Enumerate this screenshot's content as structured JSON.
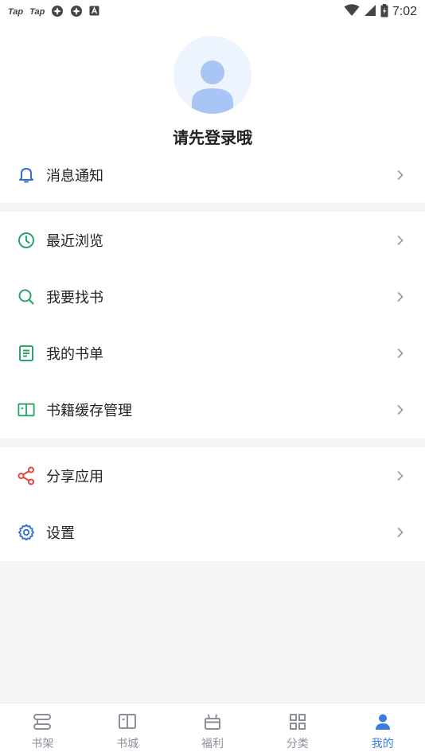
{
  "status_bar": {
    "left_labels": [
      "Tap",
      "Tap"
    ],
    "time": "7:02"
  },
  "profile": {
    "login_prompt": "请先登录哦"
  },
  "menu": {
    "notifications": "消息通知",
    "recent": "最近浏览",
    "find_book": "我要找书",
    "booklist": "我的书单",
    "cache": "书籍缓存管理",
    "share": "分享应用",
    "settings": "设置"
  },
  "colors": {
    "notify_icon": "#2f6fd8",
    "recent_icon": "#2aa569",
    "find_icon": "#2aa569",
    "booklist_icon": "#2aa569",
    "cache_icon": "#2aa569",
    "share_icon": "#e0483b",
    "settings_icon": "#2f6fd8",
    "tab_active": "#3a7de0",
    "tab_inactive": "#8a8f99"
  },
  "tabs": [
    {
      "label": "书架",
      "icon": "bookshelf-icon",
      "active": false
    },
    {
      "label": "书城",
      "icon": "book-open-icon",
      "active": false
    },
    {
      "label": "福利",
      "icon": "gift-icon",
      "active": false
    },
    {
      "label": "分类",
      "icon": "grid-icon",
      "active": false
    },
    {
      "label": "我的",
      "icon": "person-icon",
      "active": true
    }
  ]
}
